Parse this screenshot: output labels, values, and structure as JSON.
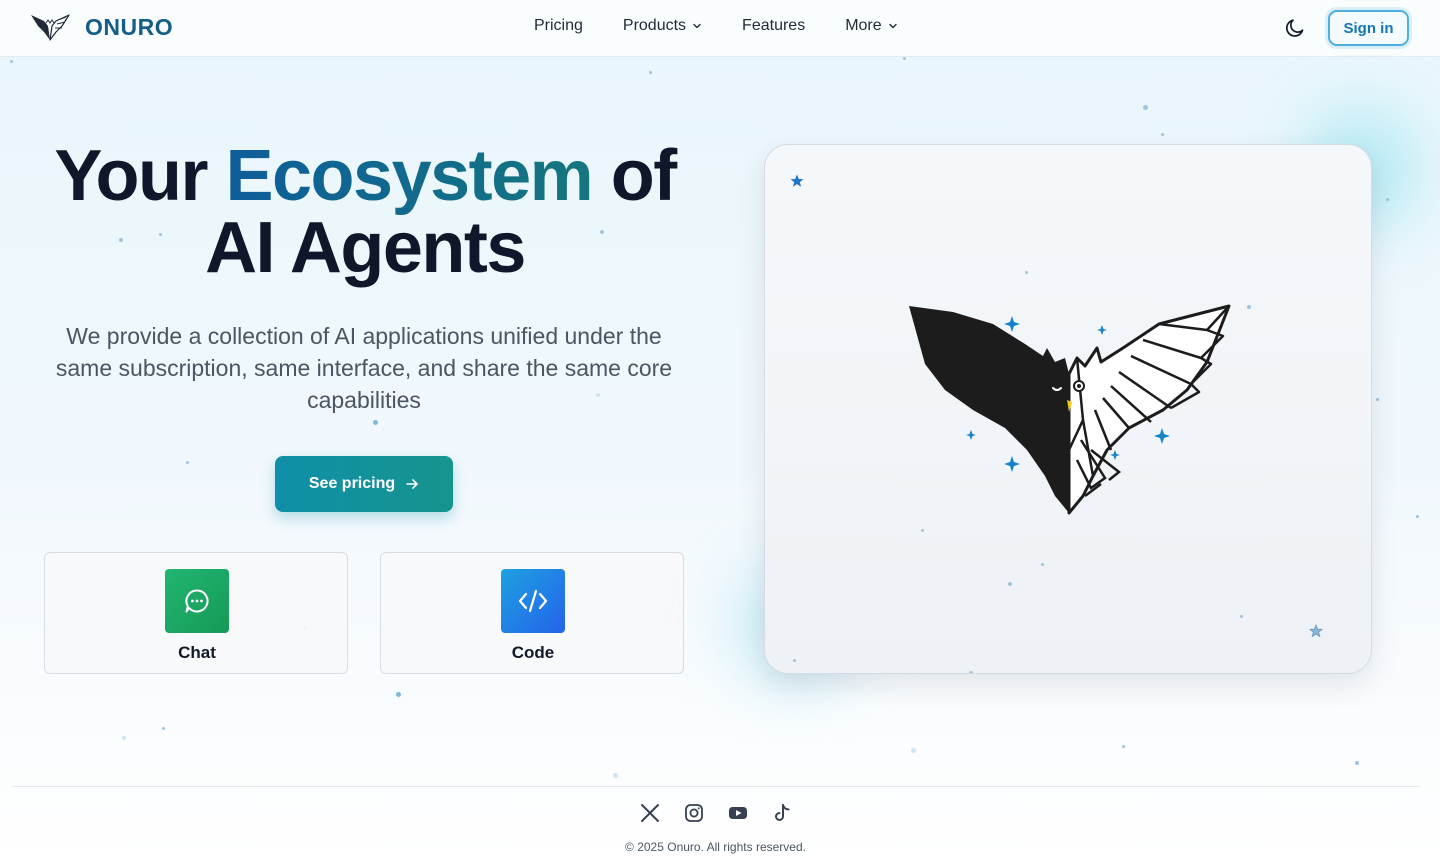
{
  "brand": {
    "name": "ONURO"
  },
  "nav": {
    "pricing": "Pricing",
    "products": "Products",
    "features": "Features",
    "more": "More"
  },
  "header": {
    "signin_label": "Sign in",
    "theme_icon": "moon-icon"
  },
  "hero": {
    "title_part1": "Your ",
    "title_accent": "Ecosystem",
    "title_part2": " of",
    "title_line2": "AI Agents",
    "subtitle": "We provide a collection of AI applications unified under the same subscription, same interface, and share the same core capabilities",
    "cta_label": "See pricing"
  },
  "apps": [
    {
      "label": "Chat",
      "icon": "chat-bubble-icon",
      "color": "#22b573"
    },
    {
      "label": "Code",
      "icon": "code-brackets-icon",
      "color": "#2563eb"
    }
  ],
  "footer": {
    "social": [
      "x-icon",
      "instagram-icon",
      "youtube-icon",
      "tiktok-icon"
    ],
    "copyright": "© 2025 Onuro. All rights reserved."
  },
  "colors": {
    "brand": "#155e85",
    "accent": "#0f8fa8",
    "signin_border": "#4fb0e0"
  }
}
